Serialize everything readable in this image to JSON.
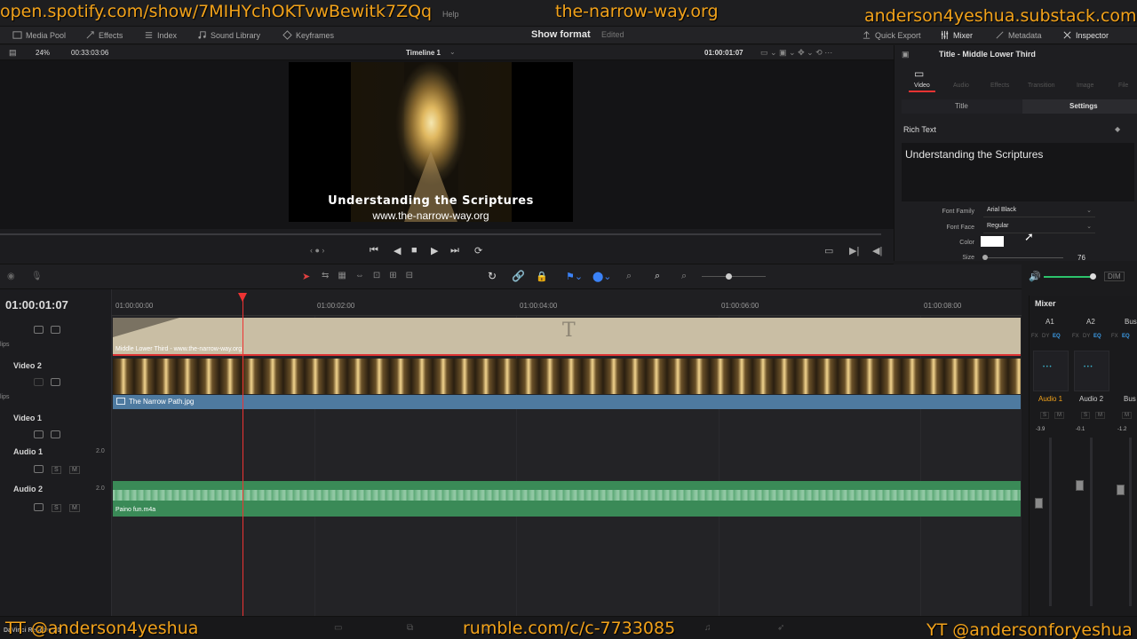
{
  "overlays": {
    "top_left": "open.spotify.com/show/7MIHYchOKTvwBewitk7ZQq",
    "top_center": "the-narrow-way.org",
    "top_right": "anderson4yeshua.substack.com",
    "bottom_left": "TT @anderson4yeshua",
    "bottom_center": "rumble.com/c/c-7733085",
    "bottom_right": "YT @andersonforyeshua"
  },
  "menu": {
    "help": "Help"
  },
  "toolbar": {
    "media_pool": "Media Pool",
    "effects": "Effects",
    "index": "Index",
    "sound_library": "Sound Library",
    "keyframes": "Keyframes",
    "show_format": "Show format",
    "edited": "Edited",
    "quick_export": "Quick Export",
    "mixer": "Mixer",
    "metadata": "Metadata",
    "inspector": "Inspector"
  },
  "viewer": {
    "zoom": "24%",
    "duration": "00:33:03:06",
    "timeline_name": "Timeline 1",
    "timecode": "01:00:01:07",
    "title_line": "Understanding the Scriptures",
    "sub_line": "www.the-narrow-way.org"
  },
  "timeline": {
    "current_timecode": "01:00:01:07",
    "ticks": [
      "01:00:00:00",
      "01:00:02:00",
      "01:00:04:00",
      "01:00:06:00",
      "01:00:08:00"
    ],
    "tracks": {
      "clips_label": "lips",
      "video2": "Video 2",
      "video1": "Video 1",
      "audio1": "Audio 1",
      "audio2": "Audio 2",
      "audio1_ch": "2.0",
      "audio2_ch": "2.0",
      "s": "S",
      "m": "M"
    },
    "clips": {
      "title_clip": "Middle Lower Third - www.the-narrow-way.org",
      "video_clip": "The Narrow Path.jpg",
      "audio_clip": "Paino fun.m4a",
      "title_glyph": "T"
    },
    "dim": "DIM"
  },
  "inspector": {
    "header": "Title - Middle Lower Third",
    "tabs": [
      "Video",
      "Audio",
      "Effects",
      "Transition",
      "Image",
      "File"
    ],
    "subtabs": [
      "Title",
      "Settings"
    ],
    "rich_text_label": "Rich Text",
    "rich_text_value": "Understanding the Scriptures",
    "font_family_label": "Font Family",
    "font_family_value": "Arial Black",
    "font_face_label": "Font Face",
    "font_face_value": "Regular",
    "color_label": "Color",
    "size_label": "Size",
    "size_value": "76"
  },
  "mixer": {
    "title": "Mixer",
    "channels": [
      "A1",
      "A2",
      "Bus"
    ],
    "channel_names": [
      "Audio 1",
      "Audio 2",
      "Bus"
    ],
    "levels": [
      "-3.9",
      "-0.1",
      "-1.2"
    ],
    "row_labels": [
      "FX",
      "DY",
      "EQ"
    ],
    "s": "S",
    "m": "M"
  },
  "bottom": {
    "app_name": "DaVinci Resolve 20"
  },
  "colors": {
    "accent": "#f2a21a",
    "playhead": "#e33333",
    "audio_clip": "#3a8a57",
    "video_label": "#4e7aa0",
    "title_clip": "#c9bea4"
  }
}
